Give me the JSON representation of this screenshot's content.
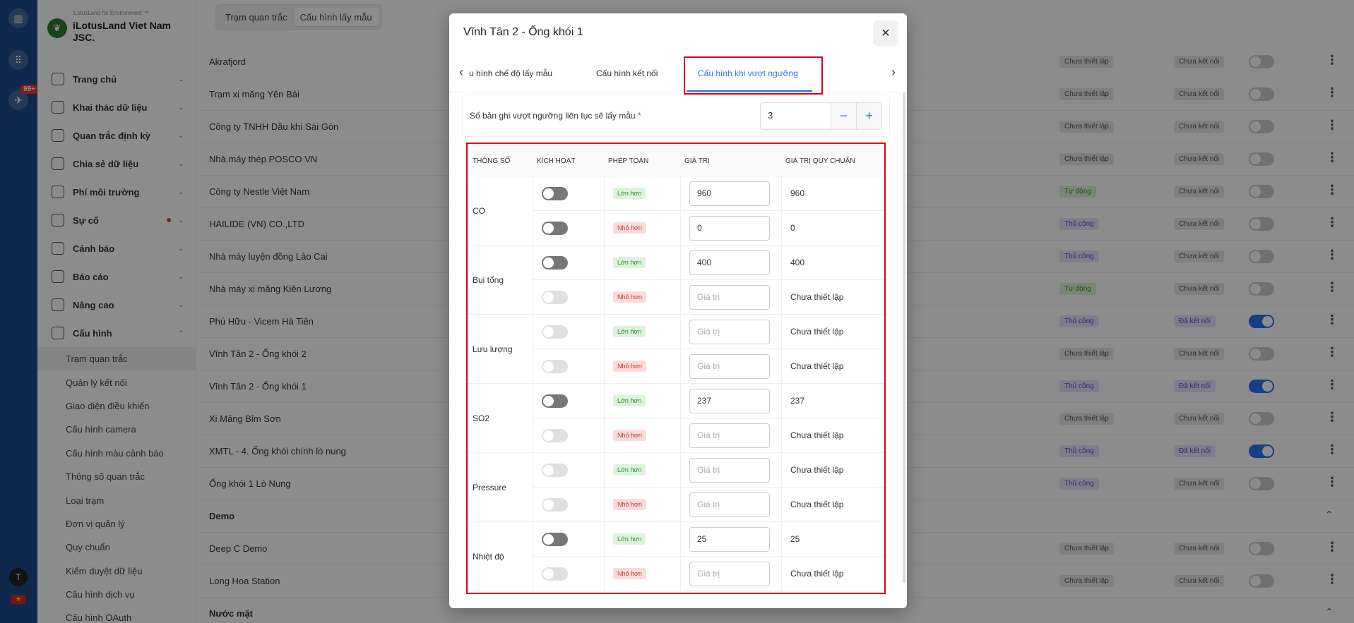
{
  "rail": {
    "badge": "99+",
    "avatar": "T"
  },
  "brand": {
    "tagline": "iLotusLand for Environment ™",
    "name": "iLotusLand Viet Nam JSC."
  },
  "menu": [
    {
      "label": "Trang chủ",
      "icon": "home-icon"
    },
    {
      "label": "Khai thác dữ liệu",
      "icon": "data-icon"
    },
    {
      "label": "Quan trắc định kỳ",
      "icon": "calendar-icon"
    },
    {
      "label": "Chia sẻ dữ liệu",
      "icon": "share-icon"
    },
    {
      "label": "Phí môi trường",
      "icon": "money-icon"
    },
    {
      "label": "Sự cố",
      "icon": "incident-icon"
    },
    {
      "label": "Cảnh báo",
      "icon": "alarm-icon"
    },
    {
      "label": "Báo cáo",
      "icon": "report-icon"
    },
    {
      "label": "Nâng cao",
      "icon": "megaphone-icon"
    },
    {
      "label": "Cấu hình",
      "icon": "config-icon"
    }
  ],
  "submenu": [
    "Trạm quan trắc",
    "Quản lý kết nối",
    "Giao diện điều khiển",
    "Cấu hình camera",
    "Cấu hình màu cảnh báo",
    "Thông số quan trắc",
    "Loại trạm",
    "Đơn vị quản lý",
    "Quy chuẩn",
    "Kiểm duyệt dữ liệu",
    "Cấu hình dịch vụ",
    "Cấu hình OAuth"
  ],
  "topseg": [
    "Trạm quan trắc",
    "Cấu hình lấy mẫu"
  ],
  "rows": [
    {
      "name": "Akrafjord",
      "b1": "Chưa thiết lập",
      "b1c": "gray",
      "b2": "Chưa kết nối",
      "b2c": "gray",
      "on": false
    },
    {
      "name": "Trạm xi măng Yên Bái",
      "b1": "Chưa thiết lập",
      "b1c": "gray",
      "b2": "Chưa kết nối",
      "b2c": "gray",
      "on": false
    },
    {
      "name": "Công ty TNHH Dầu khí Sài Gòn",
      "b1": "Chưa thiết lập",
      "b1c": "gray",
      "b2": "Chưa kết nối",
      "b2c": "gray",
      "on": false
    },
    {
      "name": "Nhà máy thép POSCO VN",
      "b1": "Chưa thiết lập",
      "b1c": "gray",
      "b2": "Chưa kết nối",
      "b2c": "gray",
      "on": false
    },
    {
      "name": "Công ty Nestle Việt Nam",
      "b1": "Tự động",
      "b1c": "green",
      "b2": "Chưa kết nối",
      "b2c": "gray",
      "on": false
    },
    {
      "name": "HAILIDE (VN) CO.,LTD",
      "b1": "Thủ công",
      "b1c": "purple",
      "b2": "Chưa kết nối",
      "b2c": "gray",
      "on": false
    },
    {
      "name": "Nhà máy luyện đồng Lào Cai",
      "b1": "Thủ công",
      "b1c": "purple",
      "b2": "Chưa kết nối",
      "b2c": "gray",
      "on": false
    },
    {
      "name": "Nhà máy xi măng Kiên Lương",
      "b1": "Tự động",
      "b1c": "green",
      "b2": "Chưa kết nối",
      "b2c": "gray",
      "on": false
    },
    {
      "name": "Phú Hữu - Vicem Hà Tiên",
      "b1": "Thủ công",
      "b1c": "purple",
      "b2": "Đã kết nối",
      "b2c": "purple",
      "on": true
    },
    {
      "name": "Vĩnh Tân 2 - Ống khói 2",
      "b1": "Chưa thiết lập",
      "b1c": "gray",
      "b2": "Chưa kết nối",
      "b2c": "gray",
      "on": false
    },
    {
      "name": "Vĩnh Tân 2 - Ống khói 1",
      "b1": "Thủ công",
      "b1c": "purple",
      "b2": "Đã kết nối",
      "b2c": "purple",
      "on": true
    },
    {
      "name": "Xi Măng Bỉm Sơn",
      "b1": "Chưa thiết lập",
      "b1c": "gray",
      "b2": "Chưa kết nối",
      "b2c": "gray",
      "on": false
    },
    {
      "name": "XMTL - 4. Ống khói chính lò nung",
      "b1": "Thủ công",
      "b1c": "purple",
      "b2": "Đã kết nối",
      "b2c": "purple",
      "on": true
    },
    {
      "name": "Ống khói 1 Lò Nung",
      "b1": "Thủ công",
      "b1c": "purple",
      "b2": "Chưa kết nối",
      "b2c": "gray",
      "on": false
    },
    {
      "name": "Demo",
      "group": true
    },
    {
      "name": "Deep C Demo",
      "b1": "Chưa thiết lập",
      "b1c": "gray",
      "b2": "Chưa kết nối",
      "b2c": "gray",
      "on": false
    },
    {
      "name": "Long Hoa Station",
      "b1": "Chưa thiết lập",
      "b1c": "gray",
      "b2": "Chưa kết nối",
      "b2c": "gray",
      "on": false
    },
    {
      "name": "Nước mặt",
      "group": true
    }
  ],
  "modal": {
    "title": "Vĩnh Tân 2 - Ống khói 1",
    "tabs": [
      "u hình chế độ lấy mẫu",
      "Cấu hình kết nối",
      "Cấu hình khi vượt ngưỡng"
    ],
    "count_label": "Số bản ghi vượt ngưỡng liên tục sẽ lấy mẫu",
    "count_required": "*",
    "count_value": "3",
    "minus": "−",
    "plus": "+",
    "headers": [
      "Thông số",
      "Kích hoạt",
      "Phép toán",
      "Giá trị",
      "Giá trị quy chuẩn"
    ],
    "placeholder": "Giá trị",
    "params": [
      {
        "name": "CO",
        "rows": [
          {
            "op": "Lớn hơn",
            "type": "gt",
            "value": "960",
            "std": "960",
            "enabled": true
          },
          {
            "op": "Nhỏ hơn",
            "type": "lt",
            "value": "0",
            "std": "0",
            "enabled": true
          }
        ]
      },
      {
        "name": "Bụi tổng",
        "rows": [
          {
            "op": "Lớn hơn",
            "type": "gt",
            "value": "400",
            "std": "400",
            "enabled": true
          },
          {
            "op": "Nhỏ hơn",
            "type": "lt",
            "value": "",
            "std": "Chưa thiết lập",
            "enabled": false
          }
        ]
      },
      {
        "name": "Lưu lượng",
        "rows": [
          {
            "op": "Lớn hơn",
            "type": "gt",
            "value": "",
            "std": "Chưa thiết lập",
            "enabled": false
          },
          {
            "op": "Nhỏ hơn",
            "type": "lt",
            "value": "",
            "std": "Chưa thiết lập",
            "enabled": false
          }
        ]
      },
      {
        "name": "SO2",
        "rows": [
          {
            "op": "Lớn hơn",
            "type": "gt",
            "value": "237",
            "std": "237",
            "enabled": true
          },
          {
            "op": "Nhỏ hơn",
            "type": "lt",
            "value": "",
            "std": "Chưa thiết lập",
            "enabled": false
          }
        ]
      },
      {
        "name": "Pressure",
        "rows": [
          {
            "op": "Lớn hơn",
            "type": "gt",
            "value": "",
            "std": "Chưa thiết lập",
            "enabled": false
          },
          {
            "op": "Nhỏ hơn",
            "type": "lt",
            "value": "",
            "std": "Chưa thiết lập",
            "enabled": false
          }
        ]
      },
      {
        "name": "Nhiệt độ",
        "rows": [
          {
            "op": "Lớn hơn",
            "type": "gt",
            "value": "25",
            "std": "25",
            "enabled": true
          },
          {
            "op": "Nhỏ hơn",
            "type": "lt",
            "value": "",
            "std": "Chưa thiết lập",
            "enabled": false
          }
        ]
      }
    ]
  }
}
